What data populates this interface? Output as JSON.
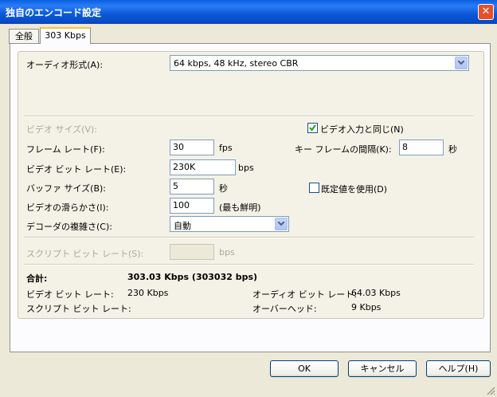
{
  "window": {
    "title": "独自のエンコード設定",
    "close_glyph": "✕"
  },
  "tabs": [
    {
      "label": "全般"
    },
    {
      "label": "303 Kbps"
    }
  ],
  "audio": {
    "label": "オーディオ形式(A):",
    "value": "64 kbps, 48 kHz, stereo CBR"
  },
  "video": {
    "size_label": "ビデオ サイズ(V):",
    "same_as_input_label": "ビデオ入力と同じ(N)",
    "framerate": {
      "label": "フレーム レート(F):",
      "value": "30",
      "unit": "fps"
    },
    "keyframe": {
      "label": "キー フレームの間隔(K):",
      "value": "8",
      "unit": "秒"
    },
    "bitrate": {
      "label": "ビデオ ビット レート(E):",
      "value": "230K",
      "unit": "bps"
    },
    "buffer": {
      "label": "バッファ サイズ(B):",
      "value": "5",
      "unit": "秒"
    },
    "use_default_label": "既定値を使用(D)",
    "smoothness": {
      "label": "ビデオの滑らかさ(I):",
      "value": "100",
      "note": "(最も鮮明)"
    },
    "decoder": {
      "label": "デコーダの複雑さ(C):",
      "value": "自動"
    }
  },
  "script": {
    "label": "スクリプト ビット レート(S):",
    "unit": "bps"
  },
  "summary": {
    "total_label": "合計:",
    "total_value": "303.03 Kbps (303032 bps)",
    "video_label": "ビデオ ビット レート:",
    "video_value": "230 Kbps",
    "script_label": "スクリプト ビット レート:",
    "audio_label": "オーディオ ビット レート:",
    "audio_value": "64.03 Kbps",
    "overhead_label": "オーバーヘッド:",
    "overhead_value": "9 Kbps"
  },
  "buttons": {
    "ok": "OK",
    "cancel": "キャンセル",
    "help": "ヘルプ(H)"
  }
}
